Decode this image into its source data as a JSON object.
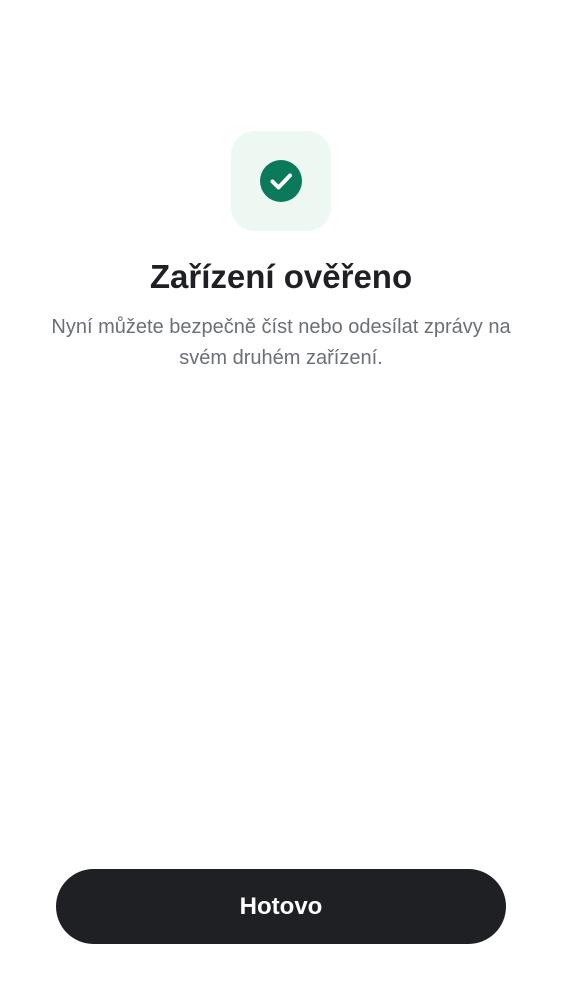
{
  "icon": {
    "name": "check-circle-icon",
    "tile_color": "#eef8f3",
    "circle_color": "#0a7a5a",
    "check_color": "#ffffff"
  },
  "title": "Zařízení ověřeno",
  "subtitle": "Nyní můžete bezpečně číst nebo odesílat zprávy na svém druhém zařízení.",
  "button": {
    "done_label": "Hotovo",
    "background": "#1f2024",
    "text_color": "#ffffff"
  }
}
